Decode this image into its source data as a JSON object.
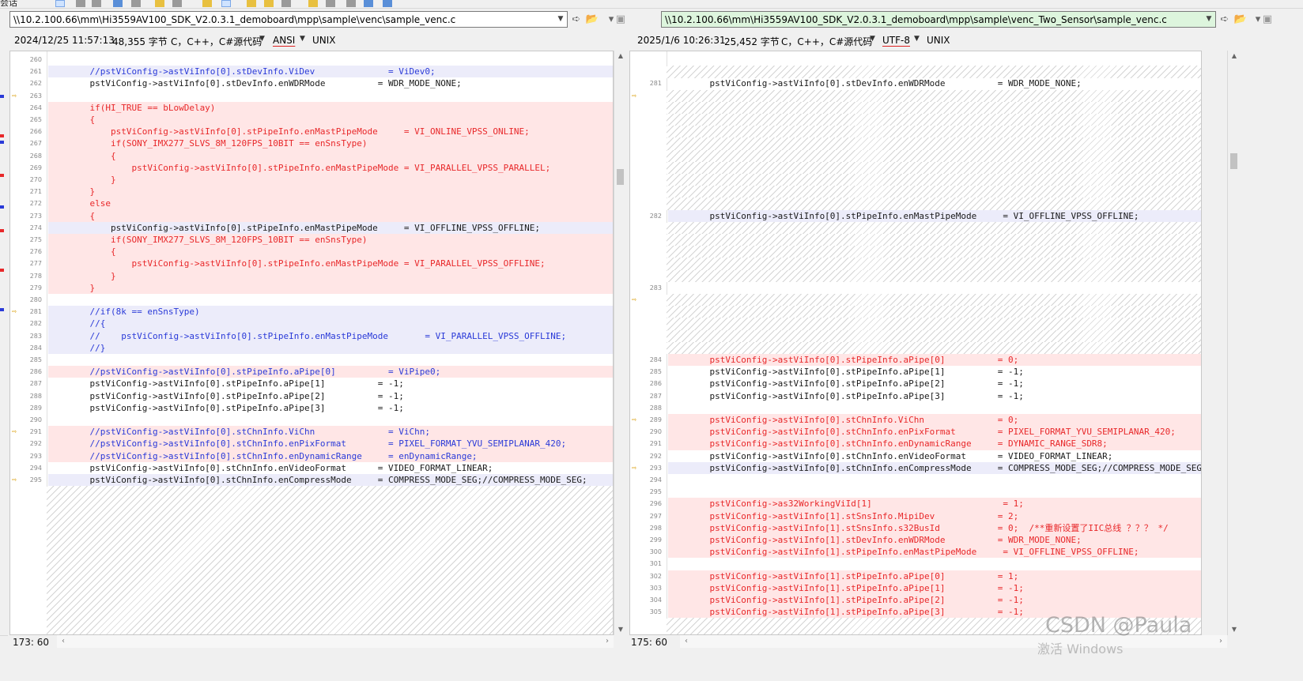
{
  "toolbar": {
    "menu_label": "会话"
  },
  "left": {
    "path": "\\\\10.2.100.66\\mm\\Hi3559AV100_SDK_V2.0.3.1_demoboard\\mpp\\sample\\venc\\sample_venc.c",
    "datetime": "2024/12/25 11:57:13",
    "size": "48,355 字节",
    "filetype": "C，C++，C#源代码",
    "encoding": "ANSI",
    "eol": "UNIX",
    "status": "173: 60",
    "rows": [
      {
        "ln": "260",
        "text": "",
        "cls": "lav"
      },
      {
        "ln": "261",
        "text": "    //pstViConfig->astViInfo[0].stDevInfo.ViDev              = ViDev0;",
        "cls": "lav",
        "color": "blue"
      },
      {
        "ln": "262",
        "text": "    pstViConfig->astViInfo[0].stDevInfo.enWDRMode          = WDR_MODE_NONE;",
        "cls": "",
        "color": "black"
      },
      {
        "ln": "263",
        "text": "",
        "cls": "lav",
        "arrow": true
      },
      {
        "ln": "264",
        "text": "    if(HI_TRUE == bLowDelay)",
        "cls": "pink",
        "color": "red"
      },
      {
        "ln": "265",
        "text": "    {",
        "cls": "pink",
        "color": "red"
      },
      {
        "ln": "266",
        "text": "        pstViConfig->astViInfo[0].stPipeInfo.enMastPipeMode     = VI_ONLINE_VPSS_ONLINE;",
        "cls": "pink",
        "color": "red"
      },
      {
        "ln": "267",
        "text": "        if(SONY_IMX277_SLVS_8M_120FPS_10BIT == enSnsType)",
        "cls": "pink",
        "color": "red"
      },
      {
        "ln": "268",
        "text": "        {",
        "cls": "pink",
        "color": "red"
      },
      {
        "ln": "269",
        "text": "            pstViConfig->astViInfo[0].stPipeInfo.enMastPipeMode = VI_PARALLEL_VPSS_PARALLEL;",
        "cls": "pink",
        "color": "red"
      },
      {
        "ln": "270",
        "text": "        }",
        "cls": "pink",
        "color": "red"
      },
      {
        "ln": "271",
        "text": "    }",
        "cls": "pink",
        "color": "red"
      },
      {
        "ln": "272",
        "text": "    else",
        "cls": "pink",
        "color": "red"
      },
      {
        "ln": "273",
        "text": "    {",
        "cls": "pink",
        "color": "red"
      },
      {
        "ln": "274",
        "text": "        pstViConfig->astViInfo[0].stPipeInfo.enMastPipeMode     = VI_OFFLINE_VPSS_OFFLINE;",
        "cls": "lav",
        "color": "black"
      },
      {
        "ln": "275",
        "text": "        if(SONY_IMX277_SLVS_8M_120FPS_10BIT == enSnsType)",
        "cls": "pink",
        "color": "red"
      },
      {
        "ln": "276",
        "text": "        {",
        "cls": "pink",
        "color": "red"
      },
      {
        "ln": "277",
        "text": "            pstViConfig->astViInfo[0].stPipeInfo.enMastPipeMode = VI_PARALLEL_VPSS_OFFLINE;",
        "cls": "pink",
        "color": "red"
      },
      {
        "ln": "278",
        "text": "        }",
        "cls": "pink",
        "color": "red"
      },
      {
        "ln": "279",
        "text": "    }",
        "cls": "pink",
        "color": "red"
      },
      {
        "ln": "280",
        "text": "",
        "cls": ""
      },
      {
        "ln": "281",
        "text": "    //if(8k == enSnsType)",
        "cls": "lav",
        "color": "blue",
        "arrow": true
      },
      {
        "ln": "282",
        "text": "    //{",
        "cls": "lav",
        "color": "blue"
      },
      {
        "ln": "283",
        "text": "    //    pstViConfig->astViInfo[0].stPipeInfo.enMastPipeMode       = VI_PARALLEL_VPSS_OFFLINE;",
        "cls": "lav",
        "color": "blue"
      },
      {
        "ln": "284",
        "text": "    //}",
        "cls": "lav",
        "color": "blue"
      },
      {
        "ln": "285",
        "text": "",
        "cls": "lav"
      },
      {
        "ln": "286",
        "text": "    //pstViConfig->astViInfo[0].stPipeInfo.aPipe[0]          = ViPipe0;",
        "cls": "pink",
        "color": "blue"
      },
      {
        "ln": "287",
        "text": "    pstViConfig->astViInfo[0].stPipeInfo.aPipe[1]          = -1;",
        "cls": "",
        "color": "black"
      },
      {
        "ln": "288",
        "text": "    pstViConfig->astViInfo[0].stPipeInfo.aPipe[2]          = -1;",
        "cls": "",
        "color": "black"
      },
      {
        "ln": "289",
        "text": "    pstViConfig->astViInfo[0].stPipeInfo.aPipe[3]          = -1;",
        "cls": "",
        "color": "black"
      },
      {
        "ln": "290",
        "text": "",
        "cls": ""
      },
      {
        "ln": "291",
        "text": "    //pstViConfig->astViInfo[0].stChnInfo.ViChn              = ViChn;",
        "cls": "pink",
        "color": "blue",
        "arrow": true
      },
      {
        "ln": "292",
        "text": "    //pstViConfig->astViInfo[0].stChnInfo.enPixFormat        = PIXEL_FORMAT_YVU_SEMIPLANAR_420;",
        "cls": "pink",
        "color": "blue"
      },
      {
        "ln": "293",
        "text": "    //pstViConfig->astViInfo[0].stChnInfo.enDynamicRange     = enDynamicRange;",
        "cls": "pink",
        "color": "blue"
      },
      {
        "ln": "294",
        "text": "    pstViConfig->astViInfo[0].stChnInfo.enVideoFormat      = VIDEO_FORMAT_LINEAR;",
        "cls": "",
        "color": "black"
      },
      {
        "ln": "295",
        "text": "    pstViConfig->astViInfo[0].stChnInfo.enCompressMode     = COMPRESS_MODE_SEG;//COMPRESS_MODE_SEG;",
        "cls": "lav",
        "color": "black",
        "arrow": true
      }
    ]
  },
  "right": {
    "path": "\\\\10.2.100.66\\mm\\Hi3559AV100_SDK_V2.0.3.1_demoboard\\mpp\\sample\\venc_Two_Sensor\\sample_venc.c",
    "datetime": "2025/1/6 10:26:31",
    "size": "25,452 字节",
    "filetype": "C，C++，C#源代码",
    "encoding": "UTF-8",
    "eol": "UNIX",
    "status": "175: 60",
    "rows": [
      {
        "ln": "",
        "text": "",
        "cls": "lav"
      },
      {
        "ln": "",
        "text": "",
        "cls": "hatch"
      },
      {
        "ln": "281",
        "text": "    pstViConfig->astViInfo[0].stDevInfo.enWDRMode          = WDR_MODE_NONE;",
        "cls": "",
        "color": "black"
      },
      {
        "ln": "",
        "text": "",
        "cls": "hatch",
        "arrow": true
      },
      {
        "ln": "",
        "text": "",
        "cls": "hatch"
      },
      {
        "ln": "",
        "text": "",
        "cls": "hatch"
      },
      {
        "ln": "",
        "text": "",
        "cls": "hatch"
      },
      {
        "ln": "",
        "text": "",
        "cls": "hatch"
      },
      {
        "ln": "",
        "text": "",
        "cls": "hatch"
      },
      {
        "ln": "",
        "text": "",
        "cls": "hatch"
      },
      {
        "ln": "",
        "text": "",
        "cls": "hatch"
      },
      {
        "ln": "",
        "text": "",
        "cls": "hatch"
      },
      {
        "ln": "",
        "text": "",
        "cls": "hatch"
      },
      {
        "ln": "282",
        "text": "    pstViConfig->astViInfo[0].stPipeInfo.enMastPipeMode     = VI_OFFLINE_VPSS_OFFLINE;",
        "cls": "lav",
        "color": "black"
      },
      {
        "ln": "",
        "text": "",
        "cls": "hatch"
      },
      {
        "ln": "",
        "text": "",
        "cls": "hatch"
      },
      {
        "ln": "",
        "text": "",
        "cls": "hatch"
      },
      {
        "ln": "",
        "text": "",
        "cls": "hatch"
      },
      {
        "ln": "",
        "text": "",
        "cls": "hatch"
      },
      {
        "ln": "283",
        "text": "",
        "cls": ""
      },
      {
        "ln": "",
        "text": "",
        "cls": "hatch",
        "arrow": true
      },
      {
        "ln": "",
        "text": "",
        "cls": "hatch"
      },
      {
        "ln": "",
        "text": "",
        "cls": "hatch"
      },
      {
        "ln": "",
        "text": "",
        "cls": "hatch"
      },
      {
        "ln": "",
        "text": "",
        "cls": "hatch"
      },
      {
        "ln": "284",
        "text": "    pstViConfig->astViInfo[0].stPipeInfo.aPipe[0]          = 0;",
        "cls": "pink",
        "color": "red"
      },
      {
        "ln": "285",
        "text": "    pstViConfig->astViInfo[0].stPipeInfo.aPipe[1]          = -1;",
        "cls": "",
        "color": "black"
      },
      {
        "ln": "286",
        "text": "    pstViConfig->astViInfo[0].stPipeInfo.aPipe[2]          = -1;",
        "cls": "",
        "color": "black"
      },
      {
        "ln": "287",
        "text": "    pstViConfig->astViInfo[0].stPipeInfo.aPipe[3]          = -1;",
        "cls": "",
        "color": "black"
      },
      {
        "ln": "288",
        "text": "",
        "cls": ""
      },
      {
        "ln": "289",
        "text": "    pstViConfig->astViInfo[0].stChnInfo.ViChn              = 0;",
        "cls": "pink",
        "color": "red",
        "arrow": true
      },
      {
        "ln": "290",
        "text": "    pstViConfig->astViInfo[0].stChnInfo.enPixFormat        = PIXEL_FORMAT_YVU_SEMIPLANAR_420;",
        "cls": "pink",
        "color": "red"
      },
      {
        "ln": "291",
        "text": "    pstViConfig->astViInfo[0].stChnInfo.enDynamicRange     = DYNAMIC_RANGE_SDR8;",
        "cls": "pink",
        "color": "red"
      },
      {
        "ln": "292",
        "text": "    pstViConfig->astViInfo[0].stChnInfo.enVideoFormat      = VIDEO_FORMAT_LINEAR;",
        "cls": "",
        "color": "black"
      },
      {
        "ln": "293",
        "text": "    pstViConfig->astViInfo[0].stChnInfo.enCompressMode     = COMPRESS_MODE_SEG;//COMPRESS_MODE_SEG; 段压缩视",
        "cls": "lav",
        "color": "black",
        "arrow": true
      },
      {
        "ln": "294",
        "text": "",
        "cls": "lav"
      },
      {
        "ln": "295",
        "text": "",
        "cls": "lav"
      },
      {
        "ln": "296",
        "text": "    pstViConfig->as32WorkingViId[1]                         = 1;",
        "cls": "pink",
        "color": "red"
      },
      {
        "ln": "297",
        "text": "    pstViConfig->astViInfo[1].stSnsInfo.MipiDev            = 2;",
        "cls": "pink",
        "color": "red"
      },
      {
        "ln": "298",
        "text": "    pstViConfig->astViInfo[1].stSnsInfo.s32BusId           = 0;  /**重新设置了IIC总线 ？？？ */",
        "cls": "pink",
        "color": "red"
      },
      {
        "ln": "299",
        "text": "    pstViConfig->astViInfo[1].stDevInfo.enWDRMode          = WDR_MODE_NONE;",
        "cls": "pink",
        "color": "red"
      },
      {
        "ln": "300",
        "text": "    pstViConfig->astViInfo[1].stPipeInfo.enMastPipeMode     = VI_OFFLINE_VPSS_OFFLINE;",
        "cls": "pink",
        "color": "red"
      },
      {
        "ln": "301",
        "text": "",
        "cls": "lav"
      },
      {
        "ln": "302",
        "text": "    pstViConfig->astViInfo[1].stPipeInfo.aPipe[0]          = 1;",
        "cls": "pink",
        "color": "red"
      },
      {
        "ln": "303",
        "text": "    pstViConfig->astViInfo[1].stPipeInfo.aPipe[1]          = -1;",
        "cls": "pink",
        "color": "red"
      },
      {
        "ln": "304",
        "text": "    pstViConfig->astViInfo[1].stPipeInfo.aPipe[2]          = -1;",
        "cls": "pink",
        "color": "red"
      },
      {
        "ln": "305",
        "text": "    pstViConfig->astViInfo[1].stPipeInfo.aPipe[3]          = -1;",
        "cls": "pink",
        "color": "red"
      }
    ]
  },
  "watermark": "CSDN @Paula",
  "activate_text": "激活 Windows",
  "colors": {
    "pink_row": "#ffe6e6",
    "lav_row": "#ececfa",
    "red_text": "#e8282a",
    "blue_text": "#2a3ad8",
    "path_green": "#ddf5dd",
    "arrow": "#d79a00"
  },
  "icons": [
    "dropdown-icon",
    "open-folder-icon",
    "save-icon",
    "diff-arrow-icon"
  ]
}
